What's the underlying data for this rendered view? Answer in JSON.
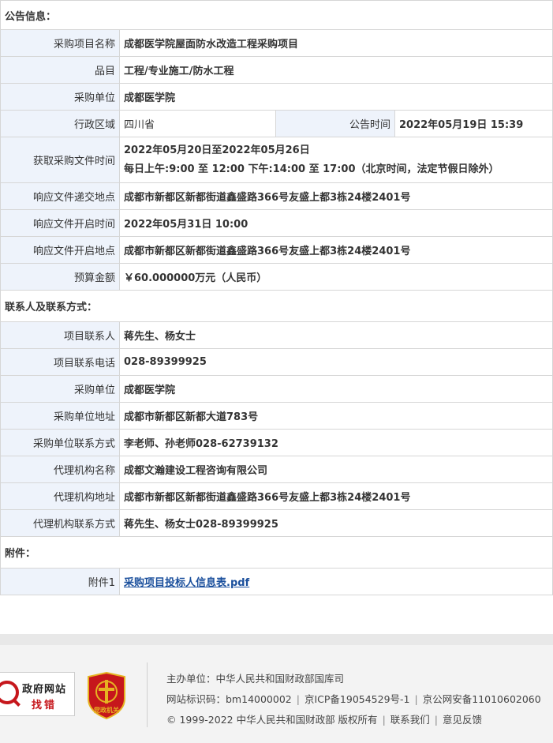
{
  "sections": {
    "announcement": "公告信息：",
    "contacts": "联系人及联系方式：",
    "attachments": "附件："
  },
  "announcement_rows": [
    {
      "label": "采购项目名称",
      "value": "成都医学院屋面防水改造工程采购项目"
    },
    {
      "label": "品目",
      "value": "工程/专业施工/防水工程"
    },
    {
      "label": "采购单位",
      "value": "成都医学院"
    }
  ],
  "region": {
    "label": "行政区域",
    "value": "四川省",
    "time_label": "公告时间",
    "time_value": "2022年05月19日 15:39"
  },
  "doc_fetch": {
    "label": "获取采购文件时间",
    "line1": "2022年05月20日至2022年05月26日",
    "line2": "每日上午:9:00 至 12:00  下午:14:00 至 17:00（北京时间，法定节假日除外）"
  },
  "response_rows": [
    {
      "label": "响应文件递交地点",
      "value": "成都市新都区新都街道鑫盛路366号友盛上都3栋24楼2401号"
    },
    {
      "label": "响应文件开启时间",
      "value": "2022年05月31日 10:00"
    },
    {
      "label": "响应文件开启地点",
      "value": "成都市新都区新都街道鑫盛路366号友盛上都3栋24楼2401号"
    },
    {
      "label": "预算金额",
      "value": "￥60.000000万元（人民币）"
    }
  ],
  "contact_rows": [
    {
      "label": "项目联系人",
      "value": "蒋先生、杨女士"
    },
    {
      "label": "项目联系电话",
      "value": "028-89399925"
    },
    {
      "label": "采购单位",
      "value": "成都医学院"
    },
    {
      "label": "采购单位地址",
      "value": "成都市新都区新都大道783号"
    },
    {
      "label": "采购单位联系方式",
      "value": "李老师、孙老师028-62739132"
    },
    {
      "label": "代理机构名称",
      "value": "成都文瀚建设工程咨询有限公司"
    },
    {
      "label": "代理机构地址",
      "value": "成都市新都区新都街道鑫盛路366号友盛上都3栋24楼2401号"
    },
    {
      "label": "代理机构联系方式",
      "value": "蒋先生、杨女士028-89399925"
    }
  ],
  "attachment": {
    "label": "附件1",
    "link_text": "采购项目投标人信息表.pdf"
  },
  "footer": {
    "gov_badge_line1": "政府网站",
    "gov_badge_line2": "找错",
    "party_badge_text": "党政机关",
    "sponsor": "主办单位：中华人民共和国财政部国库司",
    "site_id": "网站标识码：bm14000002",
    "icp": "京ICP备19054529号-1",
    "police": "京公网安备11010602060",
    "copyright": "© 1999-2022 中华人民共和国财政部 版权所有",
    "contact_us": "联系我们",
    "feedback": "意见反馈",
    "separator": "|"
  },
  "colors": {
    "label_bg": "#eef3fb",
    "border": "#d6d6d6",
    "link": "#1a4f9c",
    "emblem_red": "#c6171c",
    "emblem_gold": "#e6b422"
  }
}
